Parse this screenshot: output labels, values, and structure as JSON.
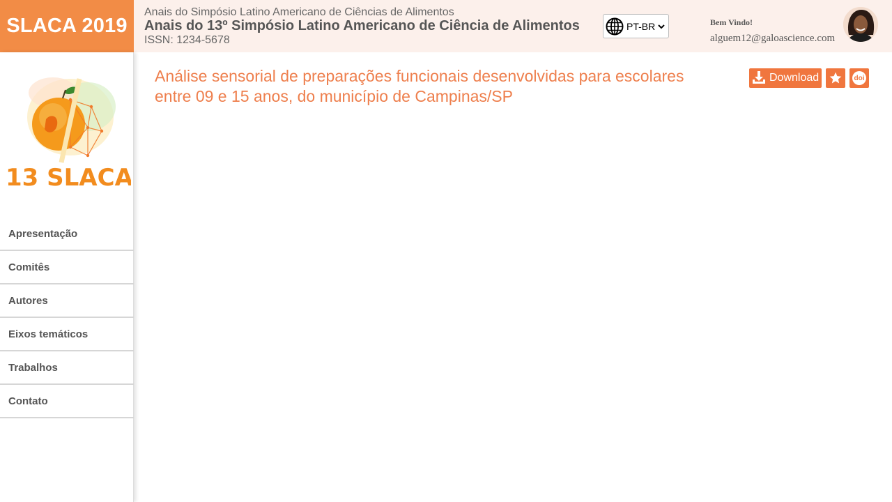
{
  "brand": {
    "title": "SLACA 2019"
  },
  "header": {
    "subtitle": "Anais do Simpósio Latino Americano de Ciências de Alimentos",
    "title": "Anais do 13º Simpósio Latino Americano de Ciência de Alimentos",
    "issn": "ISSN: 1234-5678",
    "language": {
      "selected": "PT-BR",
      "icon": "globe-icon"
    },
    "user": {
      "welcome": "Bem Vindo!",
      "email": "alguem12@galoascience.com"
    }
  },
  "sidebar": {
    "logo_text": "13 SLACA",
    "items": [
      {
        "label": "Apresentação"
      },
      {
        "label": "Comitês"
      },
      {
        "label": "Autores"
      },
      {
        "label": "Eixos temáticos"
      },
      {
        "label": "Trabalhos"
      },
      {
        "label": "Contato"
      }
    ]
  },
  "article": {
    "title": "Análise sensorial de preparações funcionais desenvolvidas para escolares entre 09 e 15 anos, do município de Campinas/SP"
  },
  "actions": {
    "download_label": "Download",
    "doi_label": "doi",
    "icons": [
      "download-icon",
      "star-icon",
      "doi-icon"
    ]
  },
  "colors": {
    "brand": "#f28c46",
    "header_bg": "#fcf0eb",
    "title": "#ee7f4d",
    "button": "#f0763e"
  }
}
